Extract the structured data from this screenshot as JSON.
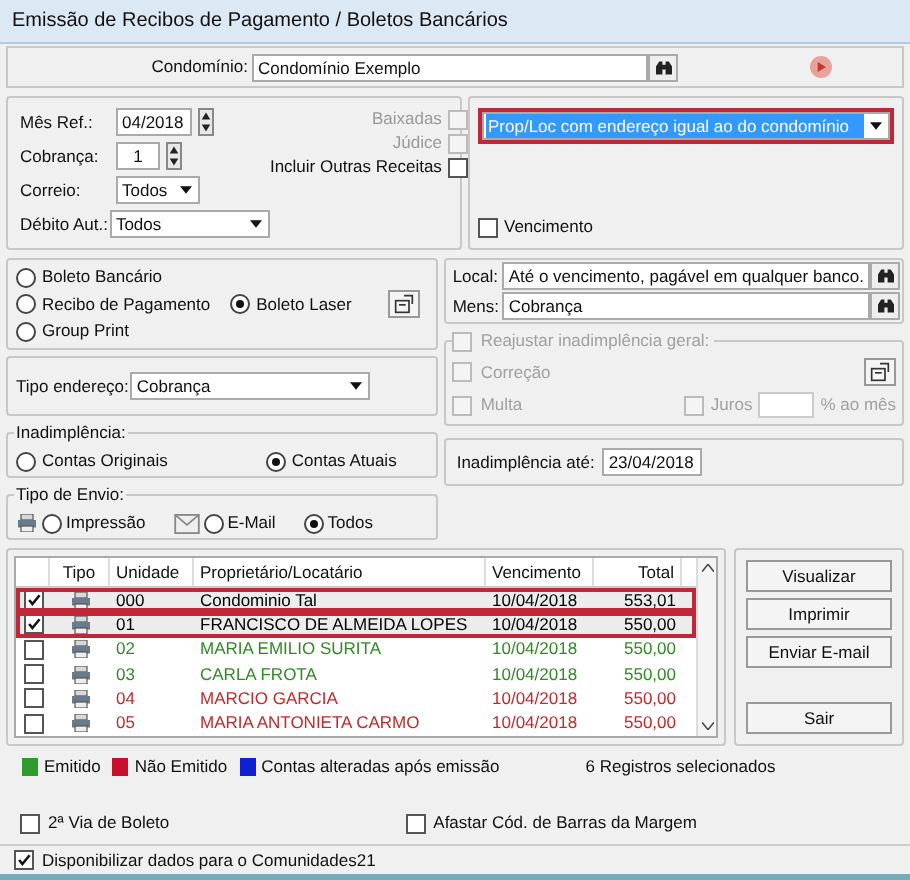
{
  "window": {
    "title": "Emissão de Recibos de Pagamento / Boletos Bancários"
  },
  "condominio": {
    "label": "Condomínio:",
    "value": "Condomínio Exemplo"
  },
  "filters": {
    "mes_ref": {
      "label": "Mês Ref.:",
      "value": "04/2018"
    },
    "cobranca": {
      "label": "Cobrança:",
      "value": "1"
    },
    "correio": {
      "label": "Correio:",
      "value": "Todos"
    },
    "debito_aut": {
      "label": "Débito Aut.:",
      "value": "Todos"
    },
    "options": [
      {
        "label": "Baixadas",
        "checked": false,
        "disabled": true
      },
      {
        "label": "Júdice",
        "checked": false,
        "disabled": true
      },
      {
        "label": "Incluir Outras Receitas",
        "checked": false,
        "disabled": false
      }
    ]
  },
  "address_filter": {
    "value": "Prop/Loc com endereço igual ao do condomínio"
  },
  "vencimento": {
    "label": "Vencimento",
    "checked": false
  },
  "document_type": [
    {
      "label": "Boleto Bancário",
      "selected": false
    },
    {
      "label": "Recibo de Pagamento",
      "selected": false
    },
    {
      "label": "Boleto Laser",
      "selected": true
    },
    {
      "label": "Group Print",
      "selected": false
    }
  ],
  "local": {
    "label": "Local:",
    "value": "Até o vencimento, pagável em qualquer banco."
  },
  "mens": {
    "label": "Mens:",
    "value": "Cobrança"
  },
  "reajustar": {
    "label": "Reajustar inadimplência geral:",
    "checked": false,
    "options": [
      {
        "label": "Correção",
        "checked": false
      },
      {
        "label": "Multa",
        "checked": false
      },
      {
        "label": "Juros",
        "checked": false
      }
    ],
    "rate_unit": "% ao mês"
  },
  "tipo_endereco": {
    "label": "Tipo endereço:",
    "value": "Cobrança"
  },
  "inadimplencia": {
    "title": "Inadimplência:",
    "options": [
      {
        "label": "Contas Originais",
        "selected": false
      },
      {
        "label": "Contas Atuais",
        "selected": true
      }
    ]
  },
  "inadimplencia_ate": {
    "label": "Inadimplência até:",
    "value": "23/04/2018"
  },
  "tipo_envio": {
    "title": "Tipo de Envio:",
    "options": [
      {
        "label": "Impressão",
        "selected": false,
        "kind": "printer"
      },
      {
        "label": "E-Mail",
        "selected": false,
        "kind": "mail"
      },
      {
        "label": "Todos",
        "selected": true,
        "kind": "plain"
      }
    ]
  },
  "table": {
    "columns": [
      "Tipo",
      "Unidade",
      "Proprietário/Locatário",
      "Vencimento",
      "Total"
    ],
    "rows": [
      {
        "checked": true,
        "selected": true,
        "unit": "000",
        "name": "Condominio Tal",
        "due": "10/04/2018",
        "total": "553,01",
        "color": "#000000"
      },
      {
        "checked": true,
        "selected": true,
        "unit": "01",
        "name": "FRANCISCO DE ALMEIDA LOPES",
        "due": "10/04/2018",
        "total": "550,00",
        "color": "#000000"
      },
      {
        "checked": false,
        "selected": false,
        "unit": "02",
        "name": "MARIA EMILIO SURITA",
        "due": "10/04/2018",
        "total": "550,00",
        "color": "#2e8b22"
      },
      {
        "checked": false,
        "selected": false,
        "unit": "03",
        "name": "CARLA FROTA",
        "due": "10/04/2018",
        "total": "550,00",
        "color": "#2e8b22"
      },
      {
        "checked": false,
        "selected": false,
        "unit": "04",
        "name": "MARCIO GARCIA",
        "due": "10/04/2018",
        "total": "550,00",
        "color": "#c62828"
      },
      {
        "checked": false,
        "selected": false,
        "unit": "05",
        "name": "MARIA ANTONIETA CARMO",
        "due": "10/04/2018",
        "total": "550,00",
        "color": "#c62828"
      }
    ]
  },
  "actions": [
    {
      "label": "Visualizar"
    },
    {
      "label": "Imprimir"
    },
    {
      "label": "Enviar E-mail"
    },
    {
      "label": "Sair"
    }
  ],
  "legend": [
    {
      "label": "Emitido",
      "color": "#2e9b2e"
    },
    {
      "label": "Não Emitido",
      "color": "#c8102e"
    },
    {
      "label": "Contas alteradas após emissão",
      "color": "#1020d0"
    }
  ],
  "selection_count": "6 Registros selecionados",
  "bottom_options": [
    {
      "label": "2ª Via de Boleto",
      "checked": false
    },
    {
      "label": "Afastar Cód. de Barras da Margem",
      "checked": false
    }
  ],
  "footer_option": {
    "label": "Disponibilizar dados para o Comunidades21",
    "checked": true
  }
}
